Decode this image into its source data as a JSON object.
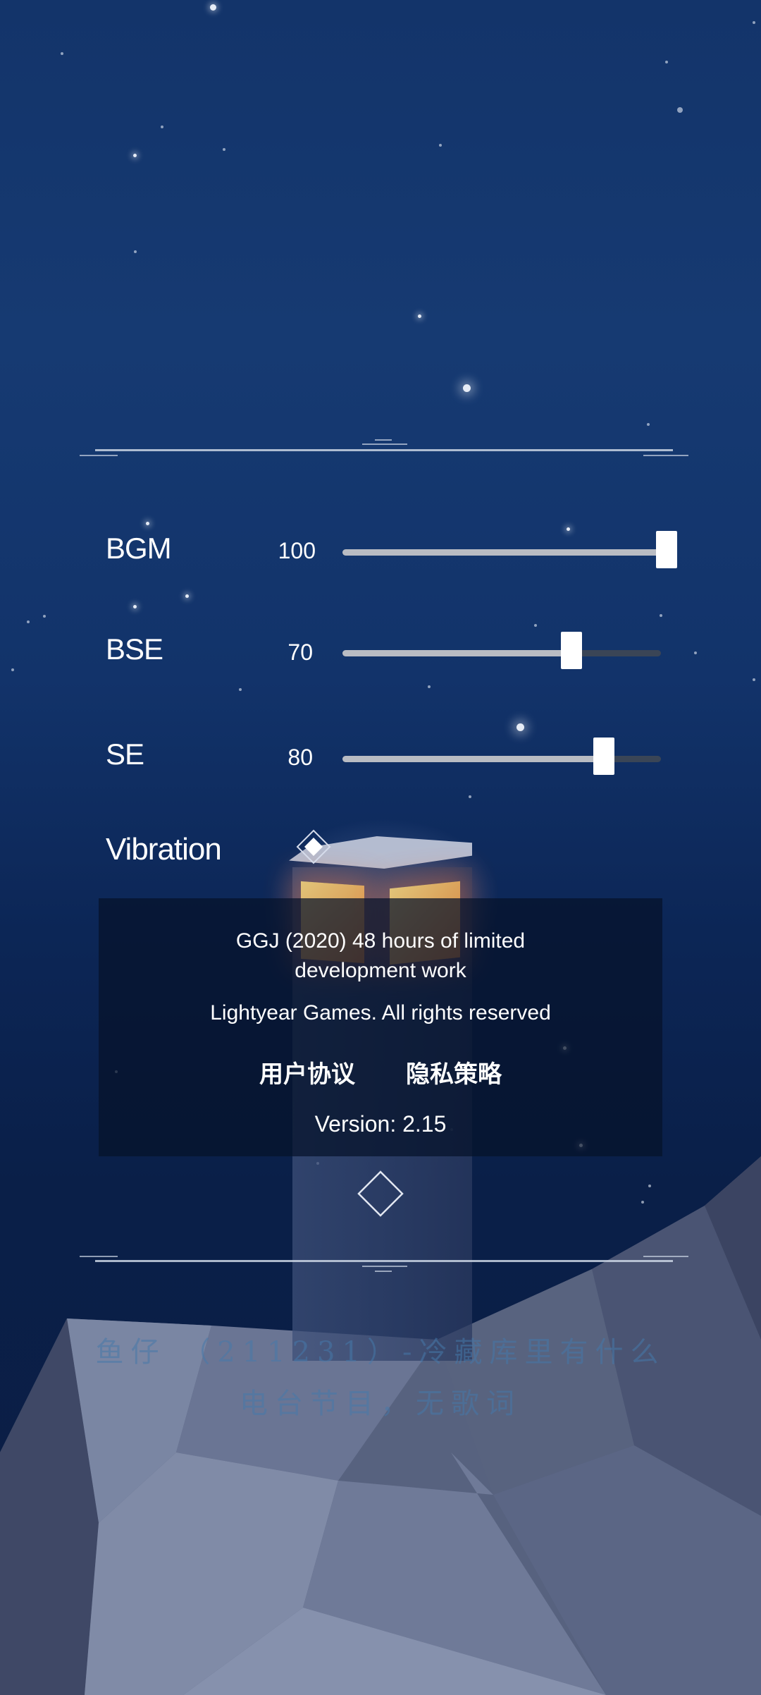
{
  "settings": [
    {
      "label": "BGM",
      "value": "100",
      "level": 1.0
    },
    {
      "label": "BSE",
      "value": "70",
      "level": 0.72
    },
    {
      "label": "SE",
      "value": "80",
      "level": 0.82
    }
  ],
  "vibration": {
    "label": "Vibration",
    "enabled": true
  },
  "info": {
    "credits": "GGJ (2020) 48 hours of limited development work",
    "rights": "Lightyear Games. All rights reserved",
    "user_agreement": "用户协议",
    "privacy_policy": "隐私策略",
    "version": "Version: 2.15"
  },
  "watermark": {
    "line1": "鱼仔 （211231）-冷藏库里有什么",
    "line2": "电台节目，无歌词"
  },
  "colors": {
    "background_top": "#13346a",
    "background_bottom": "#0a1f48",
    "slider_fill": "#b9bcc3",
    "slider_track": "#3a4556",
    "window_glow": "#e98a3b"
  }
}
